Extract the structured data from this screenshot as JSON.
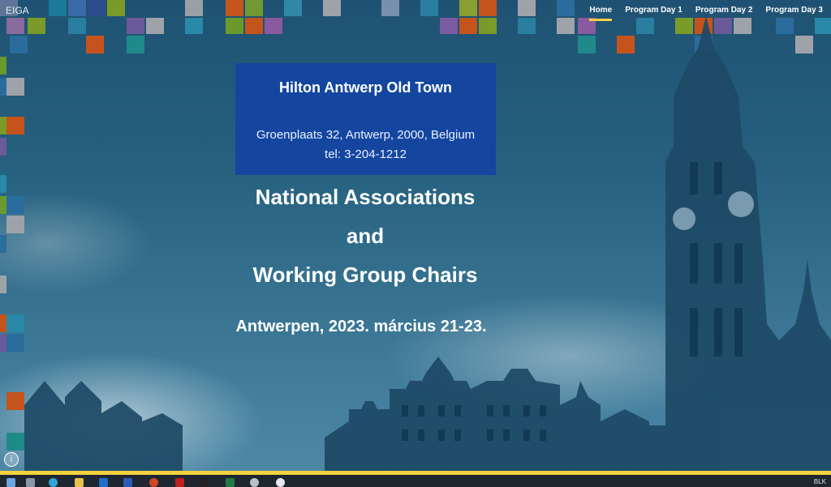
{
  "nav": {
    "brand": "EIGA",
    "items": [
      {
        "label": "Home",
        "active": true
      },
      {
        "label": "Program Day 1",
        "active": false
      },
      {
        "label": "Program Day 2",
        "active": false
      },
      {
        "label": "Program Day 3",
        "active": false
      }
    ]
  },
  "hotel": {
    "name": "Hilton Antwerp Old Town",
    "address": "Groenplaats 32, Antwerp, 2000, Belgium",
    "tel": "tel: 3-204-1212"
  },
  "event": {
    "title_line1": "National Associations",
    "title_line2": "and",
    "title_line3": "Working Group Chairs",
    "subtitle": "Antwerpen, 2023. március 21-23."
  },
  "info_icon": "info-icon",
  "taskbar": {
    "tray_text": "BLK",
    "apps": [
      "start-icon",
      "task-view-icon",
      "edge-icon",
      "file-explorer-icon",
      "outlook-icon",
      "word-icon",
      "powerpoint-icon",
      "acrobat-icon",
      "app-icon",
      "excel-icon",
      "settings-icon",
      "paint-icon"
    ]
  },
  "colors": {
    "accent": "#f5d142",
    "hotel_card": "#1446a0",
    "taskbar": "#1e2630"
  }
}
